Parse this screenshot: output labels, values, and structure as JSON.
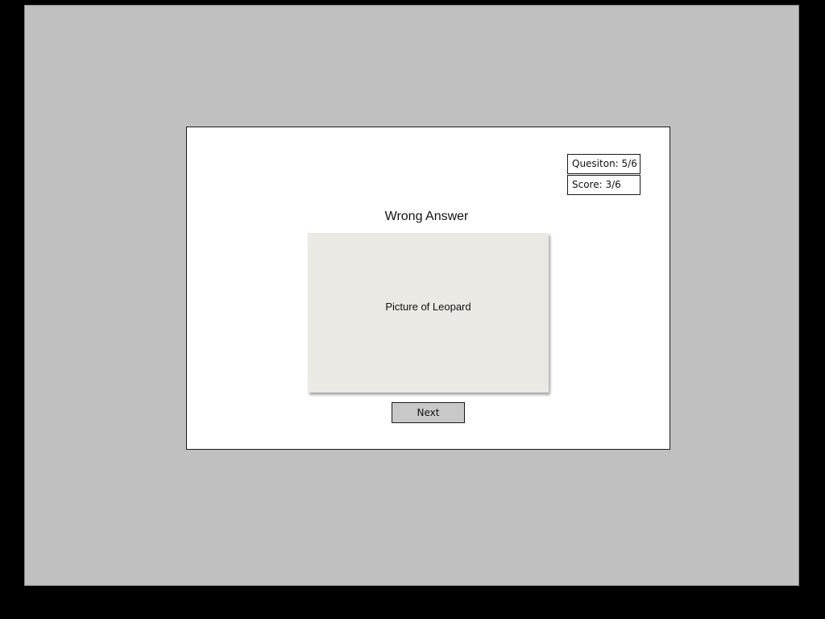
{
  "quiz": {
    "question_status": "Quesiton: 5/6",
    "score_status": "Score: 3/6",
    "result_title": "Wrong Answer",
    "picture_label": "Picture of Leopard",
    "next_label": "Next"
  },
  "colors": {
    "screen_background": "#000000",
    "backdrop": "#c0c0c0",
    "card": "#ffffff",
    "picture_placeholder": "#ece9e4",
    "button": "#c8c8c8"
  }
}
